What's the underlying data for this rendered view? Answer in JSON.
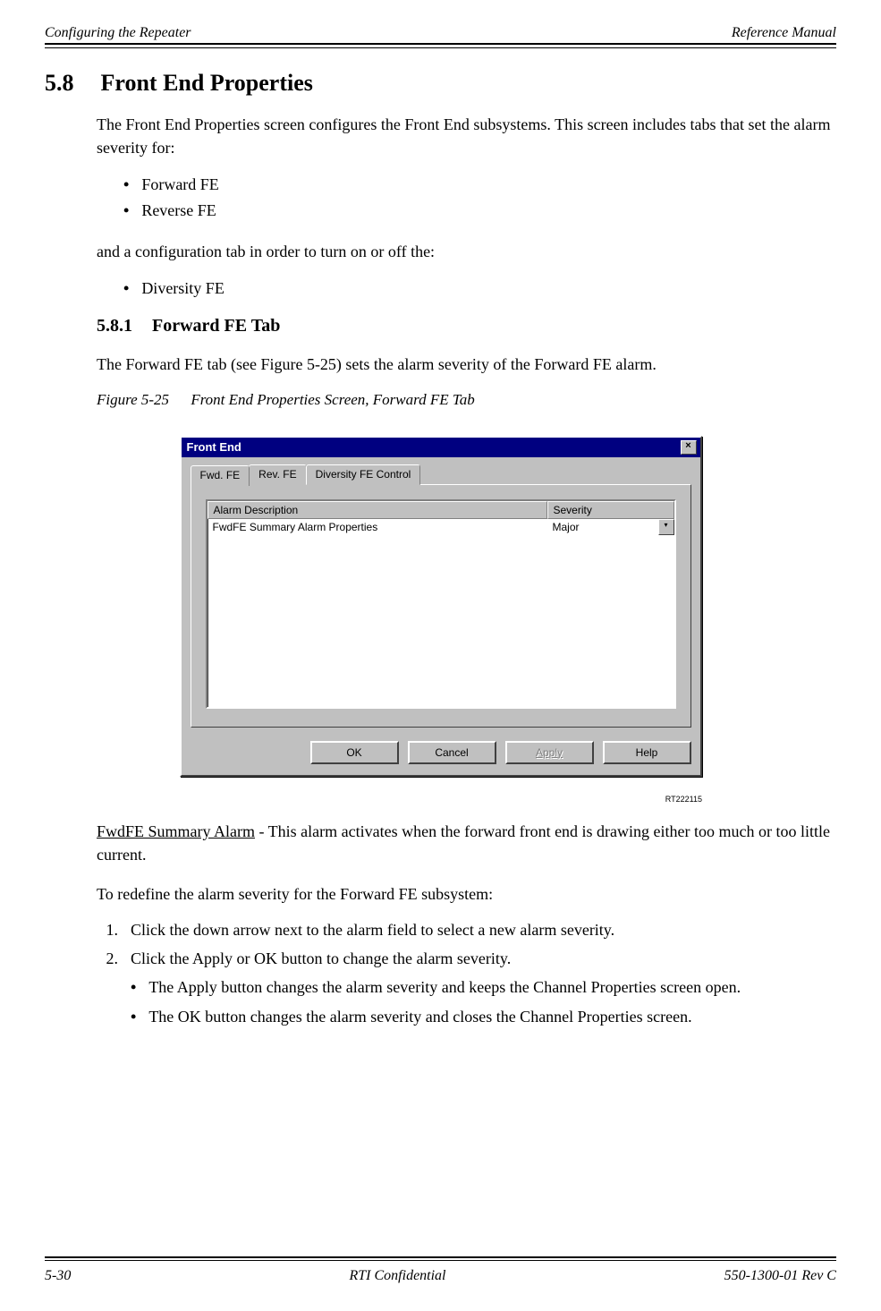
{
  "header": {
    "left": "Configuring the Repeater",
    "right": "Reference Manual"
  },
  "section": {
    "number": "5.8",
    "title": "Front End Properties"
  },
  "intro": "The Front End Properties screen configures the Front End subsystems. This screen includes tabs that set the alarm severity for:",
  "bullets1": [
    "Forward FE",
    "Reverse FE"
  ],
  "intro2": "and a configuration tab in order to turn on or off the:",
  "bullets2": [
    "Diversity FE"
  ],
  "subsection": {
    "number": "5.8.1",
    "title": "Forward FE Tab"
  },
  "sub_para": "The Forward FE tab (see Figure 5-25) sets the alarm severity of the Forward FE alarm.",
  "figure": {
    "label": "Figure 5-25",
    "caption": "Front End Properties Screen, Forward FE Tab"
  },
  "dialog": {
    "title": "Front End",
    "close_glyph": "×",
    "tabs": [
      "Fwd. FE",
      "Rev. FE",
      "Diversity FE Control"
    ],
    "col_headers": [
      "Alarm Description",
      "Severity"
    ],
    "row": {
      "desc": "FwdFE Summary Alarm Properties",
      "severity": "Major"
    },
    "buttons": {
      "ok": "OK",
      "cancel": "Cancel",
      "apply": "Apply",
      "help": "Help"
    },
    "drop_glyph": "▾"
  },
  "ref_id": "RT222115",
  "alarm_term": "FwdFE Summary Alarm",
  "alarm_desc_rest": " - This alarm activates when the forward front end is drawing either too much or too little current.",
  "redefine": "To redefine the alarm severity for the Forward FE subsystem:",
  "steps": [
    "Click the down arrow next to the alarm field to select a new alarm severity.",
    "Click the Apply or OK button to change the alarm severity."
  ],
  "notes": [
    "The Apply button changes the alarm severity and keeps the Channel Properties screen open.",
    "The OK button changes the alarm severity and closes the Channel Properties screen."
  ],
  "footer": {
    "left": "5-30",
    "center": "RTI Confidential",
    "right": "550-1300-01 Rev C"
  }
}
